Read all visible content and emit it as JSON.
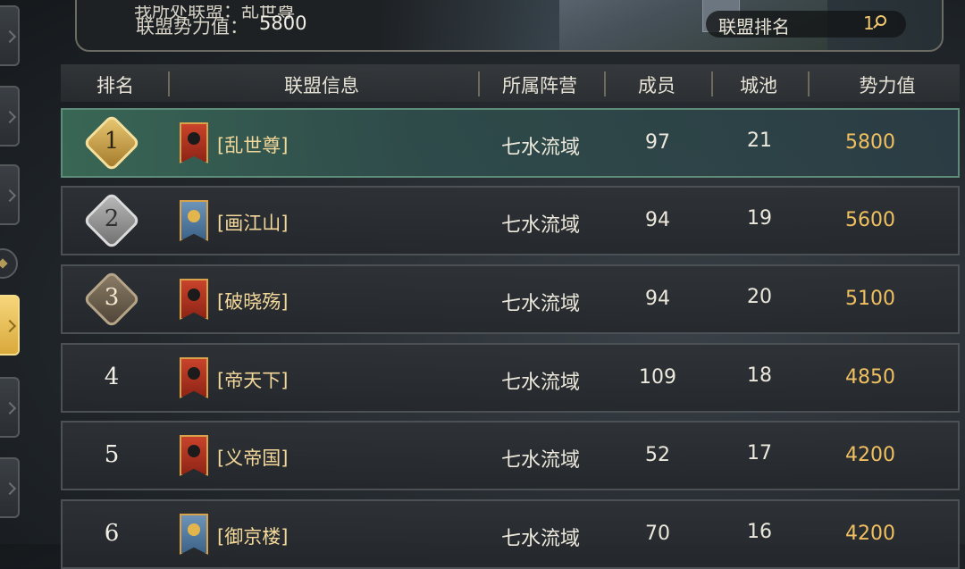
{
  "banner": {
    "cut_text": "我所处联盟：乱世尊",
    "power_label": "联盟势力值：",
    "power_value": "5800",
    "rank_label": "联盟排名",
    "rank_value": "1"
  },
  "table": {
    "headers": [
      "排名",
      "联盟信息",
      "所属阵营",
      "成员",
      "城池",
      "势力值"
    ],
    "rows": [
      {
        "rank": "1",
        "name": "[乱世尊]",
        "camp": "七水流域",
        "members": "97",
        "cities": "21",
        "power": "5800",
        "medal": "gold",
        "flag": "red"
      },
      {
        "rank": "2",
        "name": "[画江山]",
        "camp": "七水流域",
        "members": "94",
        "cities": "19",
        "power": "5600",
        "medal": "silver",
        "flag": "blue"
      },
      {
        "rank": "3",
        "name": "[破晓殇]",
        "camp": "七水流域",
        "members": "94",
        "cities": "20",
        "power": "5100",
        "medal": "bronze",
        "flag": "red"
      },
      {
        "rank": "4",
        "name": "[帝天下]",
        "camp": "七水流域",
        "members": "109",
        "cities": "18",
        "power": "4850",
        "medal": "",
        "flag": "red"
      },
      {
        "rank": "5",
        "name": "[义帝国]",
        "camp": "七水流域",
        "members": "52",
        "cities": "17",
        "power": "4200",
        "medal": "",
        "flag": "red"
      },
      {
        "rank": "6",
        "name": "[御京楼]",
        "camp": "七水流域",
        "members": "70",
        "cities": "16",
        "power": "4200",
        "medal": "",
        "flag": "blue"
      }
    ]
  },
  "colors": {
    "gold_text": "#f0c060",
    "name_text": "#f3d89a",
    "first_row_tint": "#3c6e5a",
    "active_tab": "#e8be58"
  },
  "icons": [
    "search-icon",
    "rank-medal-icon",
    "alliance-flag-icon",
    "side-tab-icon"
  ]
}
